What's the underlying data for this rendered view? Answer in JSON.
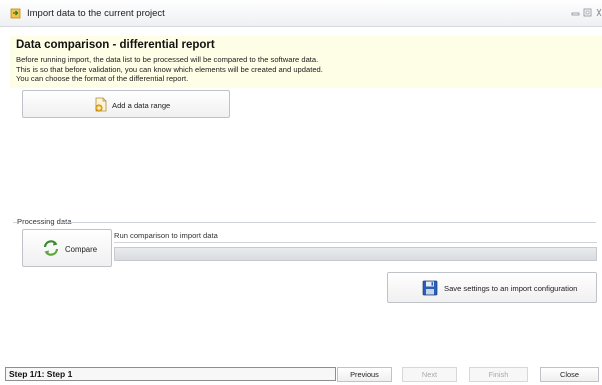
{
  "window": {
    "title": "Import data to the current project",
    "icons": {
      "app": "import-arrow-icon",
      "minimize": "minimize-icon",
      "maximize": "maximize-icon",
      "close": "close-icon"
    }
  },
  "header": {
    "title": "Data comparison - differential report",
    "description": [
      "Before running import, the data list to be processed will be compared to the software data.",
      "This is so that before validation, you can know which elements will be created and updated.",
      "You can choose the format of the differential report."
    ]
  },
  "add_range": {
    "label": "Add a data range",
    "icon": "add-document-icon"
  },
  "processing": {
    "group_label": "Processing data",
    "compare_label": "Compare",
    "compare_icon": "refresh-arrows-icon",
    "status_text": "Run comparison to import data",
    "progress": 0
  },
  "save_settings": {
    "label": "Save settings to an import configuration",
    "icon": "floppy-disk-icon"
  },
  "footer": {
    "step": "Step 1/1: Step 1",
    "buttons": {
      "previous": "Previous",
      "next": "Next",
      "finish": "Finish",
      "close": "Close"
    }
  },
  "colors": {
    "header_band": "#fefde5",
    "accent": "#3b8a2f"
  }
}
